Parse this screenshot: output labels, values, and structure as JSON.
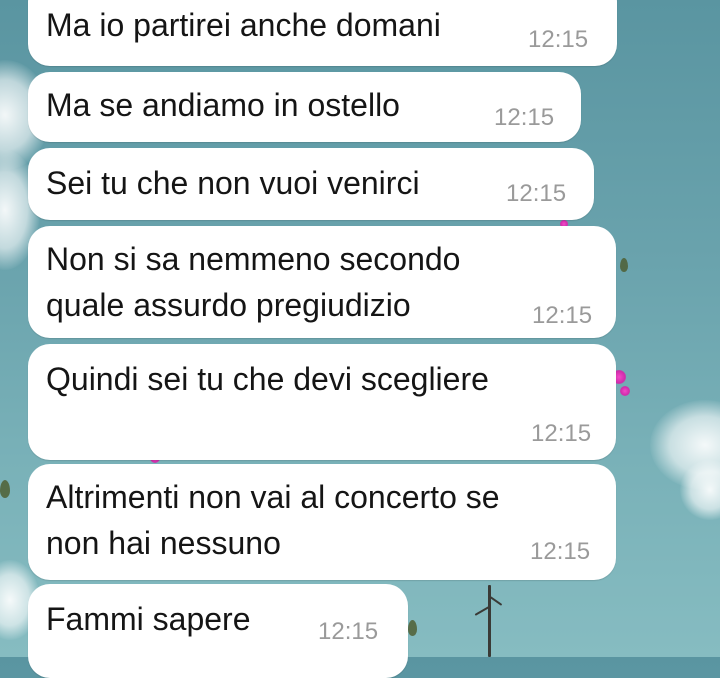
{
  "chat": {
    "messages": [
      {
        "text": "Ma io partirei anche domani",
        "time": "12:15"
      },
      {
        "text": "Ma se andiamo in ostello",
        "time": "12:15"
      },
      {
        "text": "Sei tu che non vuoi venirci",
        "time": "12:15"
      },
      {
        "text": "Non si sa nemmeno secondo\nquale assurdo pregiudizio",
        "time": "12:15"
      },
      {
        "text": "Quindi sei tu che devi scegliere",
        "time": "12:15"
      },
      {
        "text": "Altrimenti non vai al concerto se\nnon hai nessuno",
        "time": "12:15"
      },
      {
        "text": "Fammi sapere",
        "time": "12:15"
      }
    ]
  },
  "colors": {
    "bubble": "#ffffff",
    "text": "#151515",
    "timestamp": "#9a9a9a",
    "wallpaper": "#6aa3ad"
  }
}
